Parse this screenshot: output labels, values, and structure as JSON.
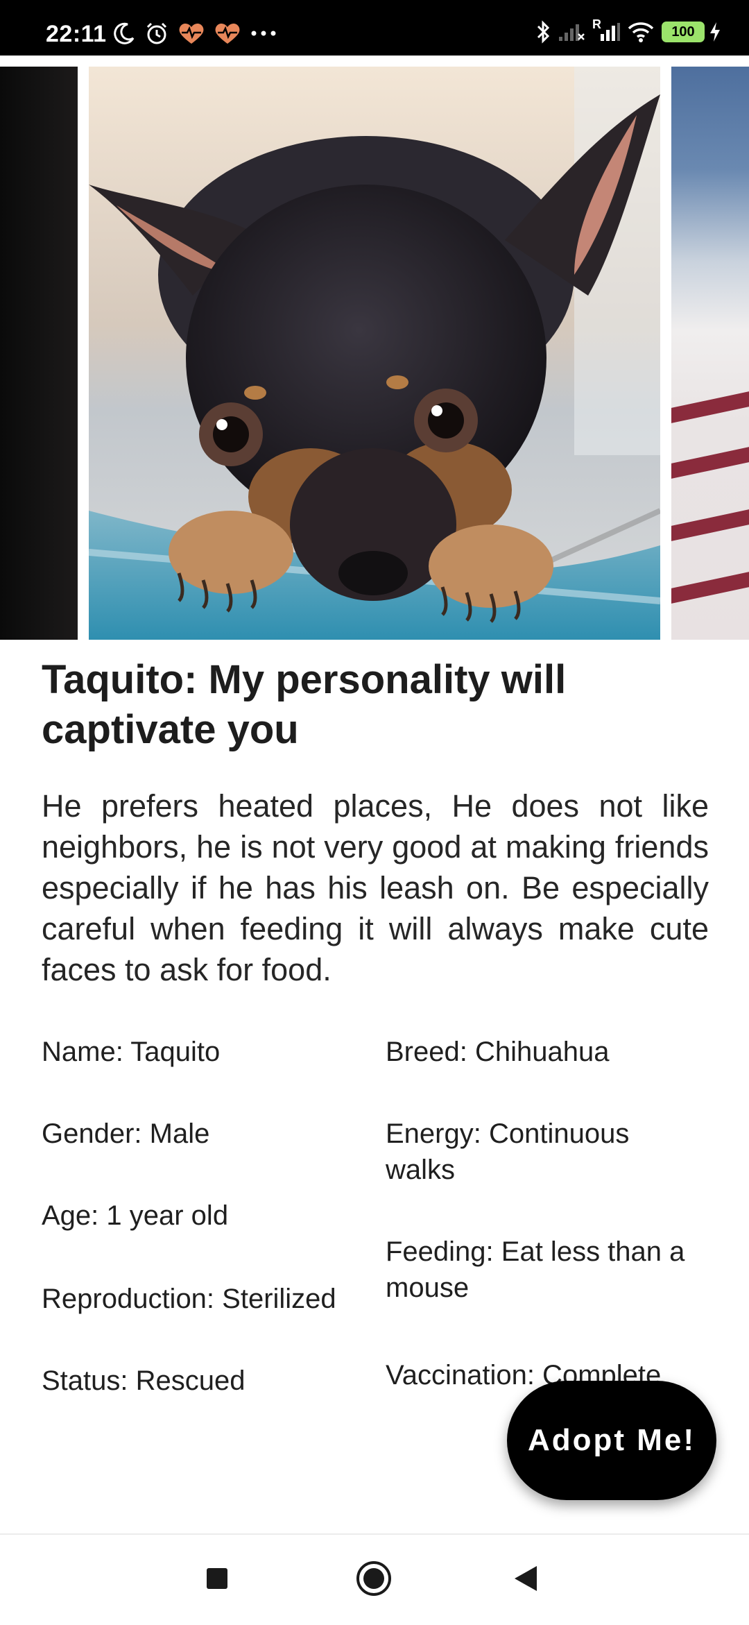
{
  "status_bar": {
    "time": "22:11",
    "left_icons": [
      "moon-icon",
      "alarm-icon",
      "health-heart-icon",
      "health-heart-icon",
      "more-dots-icon"
    ],
    "right_icons": [
      "bluetooth-icon",
      "signal-icon",
      "signal-roaming-icon",
      "wifi-icon",
      "battery-icon",
      "charging-icon"
    ],
    "roaming_label": "R",
    "battery_level": "100"
  },
  "carousel": {
    "images": [
      "dark-photo",
      "chihuahua-photo",
      "dog-on-blanket-photo"
    ]
  },
  "pet": {
    "title": "Taquito: My personality will captivate you",
    "description": "He prefers heated places, He does not like neighbors, he is not very good at making friends especially if he has his leash on. Be especially careful when feeding it will always make cute faces to ask for food."
  },
  "details": {
    "left": [
      "Name: Taquito",
      "Gender: Male",
      "Age: 1 year old",
      "Reproduction: Sterilized",
      "Status: Rescued"
    ],
    "right": [
      "Breed: Chihuahua",
      "Energy: Continuous walks",
      "Feeding: Eat less than a mouse",
      "Vaccination: Complete"
    ]
  },
  "adopt_button": {
    "label": "Adopt Me!"
  },
  "nav_bar": {
    "icons": [
      "recents-square-icon",
      "home-circle-icon",
      "back-triangle-icon"
    ]
  },
  "colors": {
    "status_bar_bg": "#000000",
    "text_primary": "#1d1d1d",
    "fab_bg": "#000000",
    "fab_text": "#ffffff",
    "battery": "#9be36b",
    "health_heart": "#e8875a"
  }
}
